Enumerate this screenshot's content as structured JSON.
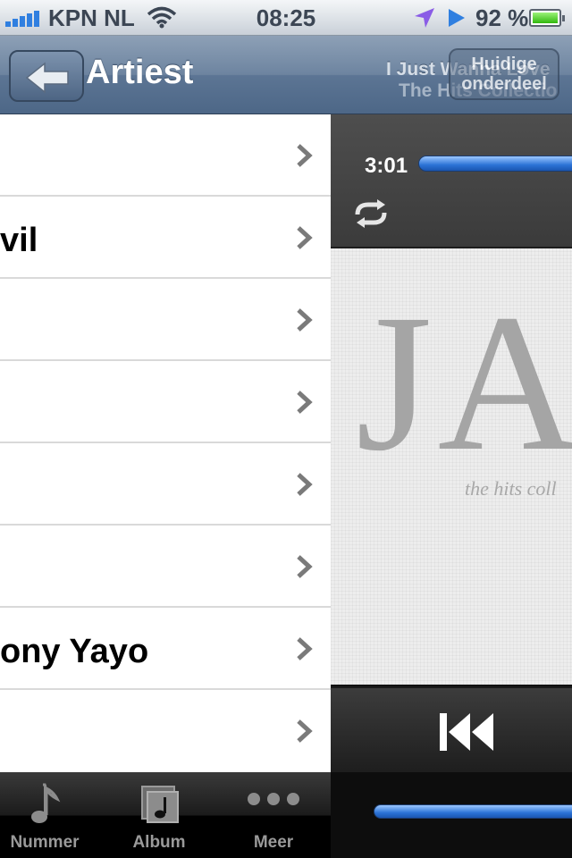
{
  "status_bar": {
    "carrier": "KPN NL",
    "time": "08:25",
    "battery_percent": "92 %"
  },
  "nav": {
    "title": "Artiest",
    "back_icon": "back-arrow-icon",
    "now_playing_track": "I Just Wanna Love",
    "now_playing_album": "The Hits Collectio",
    "now_playing_button": "Huidige onderdeel"
  },
  "list": {
    "rows": [
      {
        "label": ""
      },
      {
        "label": "vil"
      },
      {
        "label": ""
      },
      {
        "label": ""
      },
      {
        "label": ""
      },
      {
        "label": ""
      },
      {
        "label": "ony Yayo"
      },
      {
        "label": ""
      }
    ]
  },
  "tabs": [
    {
      "label": "Nummer",
      "icon": "music-note-icon"
    },
    {
      "label": "Album",
      "icon": "album-icon"
    },
    {
      "label": "Meer",
      "icon": "more-dots-icon"
    }
  ],
  "player": {
    "elapsed": "3:01",
    "artwork_text": "JA",
    "artwork_subtitle": "the hits coll",
    "repeat_icon": "repeat-icon",
    "prev_icon": "previous-track-icon",
    "volume_icon": "volume-slider"
  },
  "colors": {
    "accent_blue": "#2b73d6",
    "nav_bar": "#6d84a0"
  }
}
